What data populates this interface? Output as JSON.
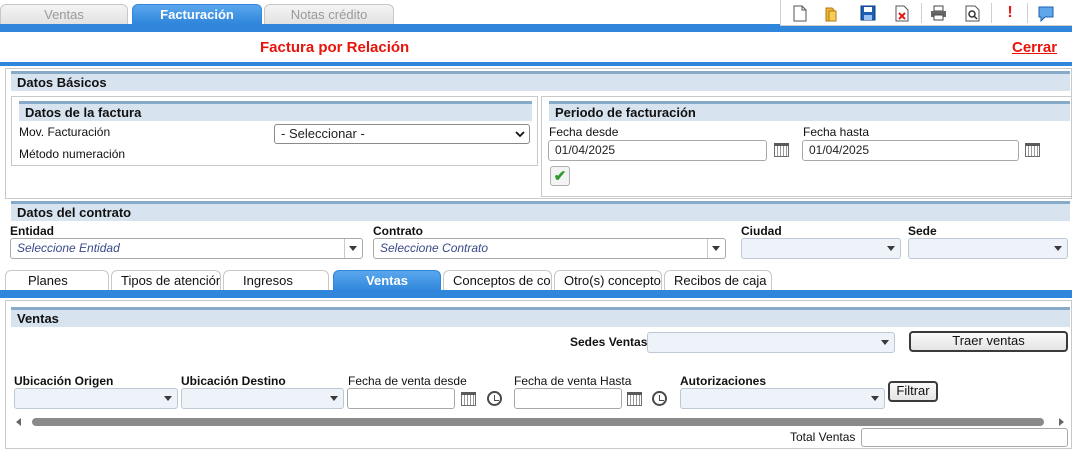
{
  "top_tabs": [
    {
      "label": "Ventas",
      "active": false
    },
    {
      "label": "Facturación",
      "active": true
    },
    {
      "label": "Notas crédito",
      "active": false
    }
  ],
  "toolbar_icons": [
    "new-document-icon",
    "open-folder-icon",
    "save-icon",
    "delete-icon",
    "print-icon",
    "preview-icon",
    "alert-icon",
    "help-chat-icon"
  ],
  "header": {
    "title": "Factura por Relación",
    "close_label": "Cerrar"
  },
  "datos_basicos": {
    "heading": "Datos Básicos",
    "factura": {
      "heading": "Datos de la factura",
      "mov_label": "Mov. Facturación",
      "mov_value": "- Seleccionar -",
      "metodo_label": "Método numeración"
    },
    "periodo": {
      "heading": "Periodo de facturación",
      "desde_label": "Fecha desde",
      "desde_value": "01/04/2025",
      "hasta_label": "Fecha hasta",
      "hasta_value": "01/04/2025"
    }
  },
  "contrato": {
    "heading": "Datos del contrato",
    "entidad_label": "Entidad",
    "entidad_placeholder": "Seleccione Entidad",
    "contrato_label": "Contrato",
    "contrato_placeholder": "Seleccione Contrato",
    "ciudad_label": "Ciudad",
    "sede_label": "Sede"
  },
  "sub_tabs": [
    {
      "label": "Planes",
      "active": false
    },
    {
      "label": "Tipos de atención",
      "active": false
    },
    {
      "label": "Ingresos",
      "active": false
    },
    {
      "label": "Ventas",
      "active": true
    },
    {
      "label": "Conceptos de cobro",
      "active": false
    },
    {
      "label": "Otro(s) conceptos",
      "active": false
    },
    {
      "label": "Recibos de caja",
      "active": false
    }
  ],
  "ventas": {
    "heading": "Ventas",
    "sedes_label": "Sedes Ventas",
    "traer_label": "Traer ventas",
    "origen_label": "Ubicación Origen",
    "destino_label": "Ubicación Destino",
    "fecha_desde_label": "Fecha de venta desde",
    "fecha_hasta_label": "Fecha de venta Hasta",
    "autorizaciones_label": "Autorizaciones",
    "filtrar_label": "Filtrar",
    "total_label": "Total Ventas"
  },
  "colors": {
    "accent": "#2f86db",
    "title_red": "#e8140c",
    "section_header": "#d7e3ef"
  }
}
